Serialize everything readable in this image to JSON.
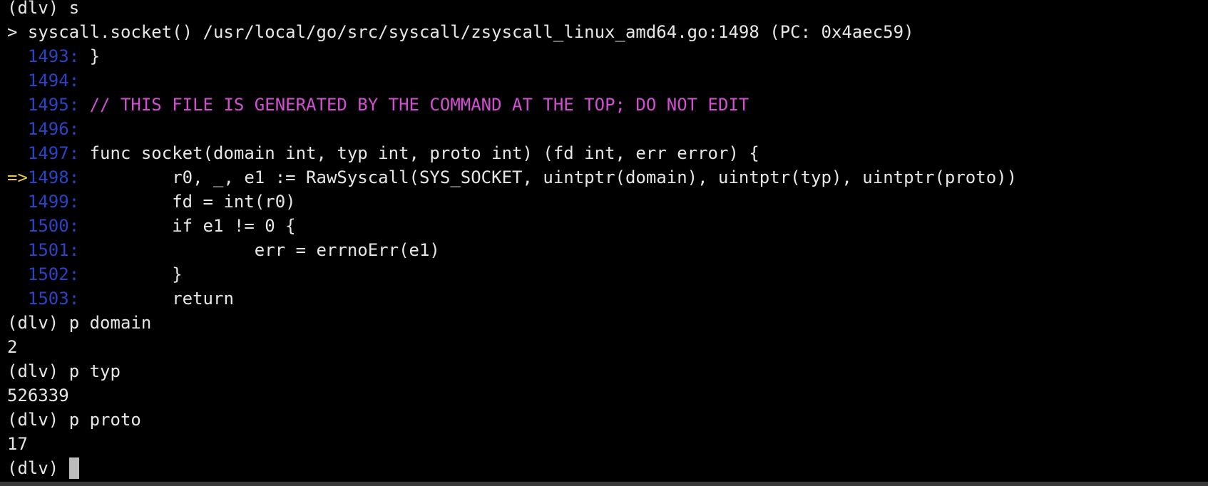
{
  "terminal": {
    "lines": [
      {
        "type": "text",
        "text": "(dlv) s"
      },
      {
        "type": "text",
        "text": "> syscall.socket() /usr/local/go/src/syscall/zsyscall_linux_amd64.go:1498 (PC: 0x4aec59)"
      },
      {
        "type": "code",
        "marker": "  ",
        "lineno": "1493:",
        "code": " }"
      },
      {
        "type": "code",
        "marker": "  ",
        "lineno": "1494:",
        "code": ""
      },
      {
        "type": "comment",
        "marker": "  ",
        "lineno": "1495:",
        "code": " // THIS FILE IS GENERATED BY THE COMMAND AT THE TOP; DO NOT EDIT"
      },
      {
        "type": "code",
        "marker": "  ",
        "lineno": "1496:",
        "code": ""
      },
      {
        "type": "code",
        "marker": "  ",
        "lineno": "1497:",
        "code": " func socket(domain int, typ int, proto int) (fd int, err error) {"
      },
      {
        "type": "code",
        "marker": "=>",
        "lineno": "1498:",
        "code": "         r0, _, e1 := RawSyscall(SYS_SOCKET, uintptr(domain), uintptr(typ), uintptr(proto))"
      },
      {
        "type": "code",
        "marker": "  ",
        "lineno": "1499:",
        "code": "         fd = int(r0)"
      },
      {
        "type": "code",
        "marker": "  ",
        "lineno": "1500:",
        "code": "         if e1 != 0 {"
      },
      {
        "type": "code",
        "marker": "  ",
        "lineno": "1501:",
        "code": "                 err = errnoErr(e1)"
      },
      {
        "type": "code",
        "marker": "  ",
        "lineno": "1502:",
        "code": "         }"
      },
      {
        "type": "code",
        "marker": "  ",
        "lineno": "1503:",
        "code": "         return"
      },
      {
        "type": "text",
        "text": "(dlv) p domain"
      },
      {
        "type": "text",
        "text": "2"
      },
      {
        "type": "text",
        "text": "(dlv) p typ"
      },
      {
        "type": "text",
        "text": "526339"
      },
      {
        "type": "text",
        "text": "(dlv) p proto"
      },
      {
        "type": "text",
        "text": "17"
      }
    ],
    "prompt": "(dlv) ",
    "colors": {
      "background": "#000000",
      "foreground": "#e6e6e6",
      "line_number": "#2a44c8",
      "comment": "#d44ed4",
      "current_line_arrow": "#e8c84a",
      "cursor": "#bdbdbd"
    }
  }
}
